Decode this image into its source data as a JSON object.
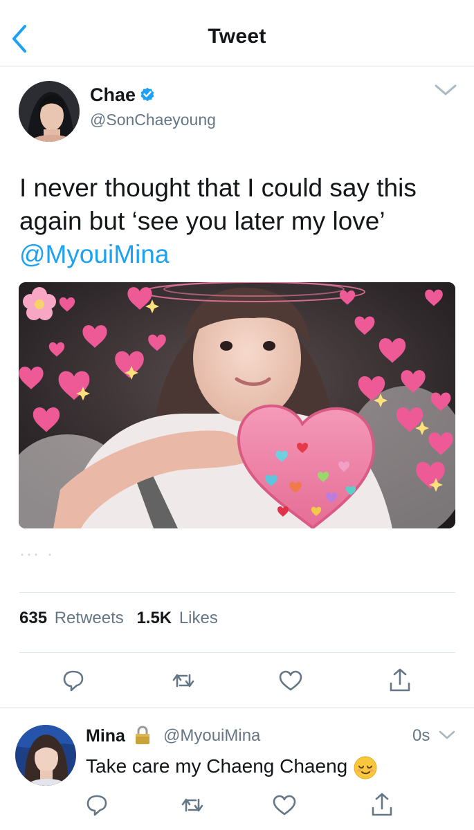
{
  "header": {
    "title": "Tweet",
    "back_icon": "chevron-left-icon"
  },
  "tweet": {
    "author": {
      "name": "Chae",
      "handle": "@SonChaeyoung",
      "verified": true
    },
    "text_line1": "I never thought that I could say this",
    "text_line2": "again but ‘see you later my love’",
    "mention": "@MyouiMina",
    "stats": {
      "retweets": "635",
      "retweets_label": "Retweets",
      "likes": "1.5K",
      "likes_label": "Likes"
    },
    "actions": [
      "reply-icon",
      "retweet-icon",
      "like-icon",
      "share-icon"
    ]
  },
  "reply": {
    "author": {
      "name": "Mina",
      "handle": "@MyouiMina",
      "protected": true
    },
    "time": "0s",
    "text": "Take care my Chaeng Chaeng",
    "emoji": "relieved-face"
  },
  "colors": {
    "accent": "#1da1f2",
    "secondary_text": "#657786",
    "divider": "#e1e8ed"
  }
}
